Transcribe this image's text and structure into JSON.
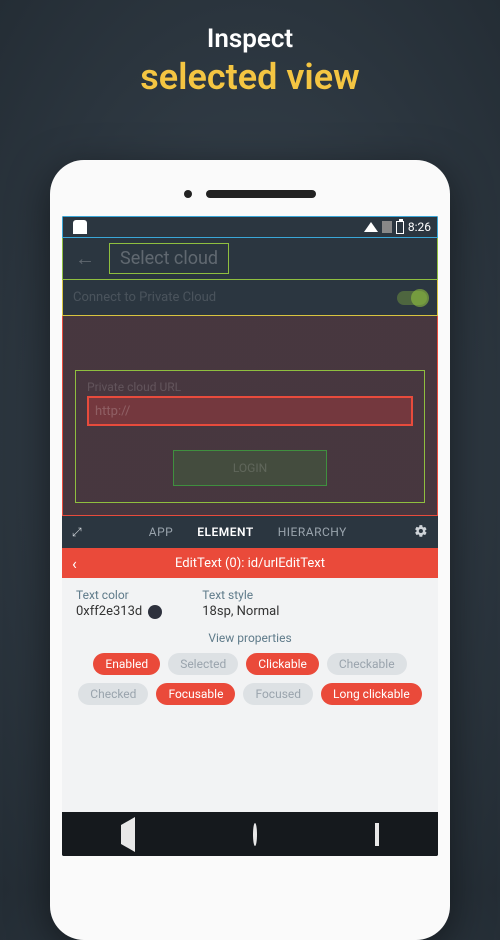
{
  "heading": {
    "line1": "Inspect",
    "line2": "selected view"
  },
  "statusbar": {
    "time": "8:26"
  },
  "toolbar": {
    "title": "Select cloud"
  },
  "connect_row": {
    "label": "Connect to Private Cloud"
  },
  "form": {
    "url_label": "Private cloud URL",
    "url_placeholder": "http://",
    "button_label": "LOGIN"
  },
  "inspector": {
    "tabs": {
      "app": "APP",
      "element": "ELEMENT",
      "hierarchy": "HIERARCHY"
    },
    "element_path": "EditText (0): id/urlEditText",
    "details": {
      "text_color_label": "Text color",
      "text_color_value": "0xff2e313d",
      "text_style_label": "Text style",
      "text_style_value": "18sp, Normal",
      "view_properties_label": "View properties"
    },
    "chips": {
      "enabled": "Enabled",
      "selected": "Selected",
      "clickable": "Clickable",
      "checkable": "Checkable",
      "checked": "Checked",
      "focusable": "Focusable",
      "focused": "Focused",
      "long_clickable": "Long clickable"
    }
  }
}
